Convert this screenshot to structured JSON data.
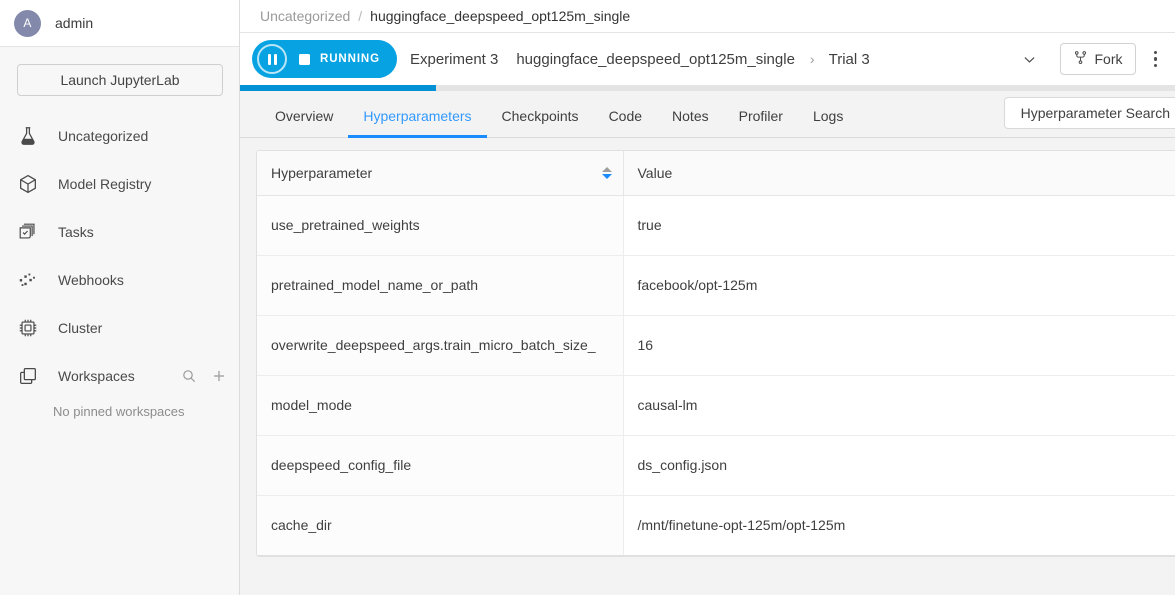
{
  "sidebar": {
    "user": {
      "initial": "A",
      "name": "admin"
    },
    "launch_button": "Launch JupyterLab",
    "items": [
      {
        "label": "Uncategorized",
        "icon": "flask-icon"
      },
      {
        "label": "Model Registry",
        "icon": "cube-icon"
      },
      {
        "label": "Tasks",
        "icon": "tasks-icon"
      },
      {
        "label": "Webhooks",
        "icon": "webhooks-icon"
      },
      {
        "label": "Cluster",
        "icon": "chip-icon"
      },
      {
        "label": "Workspaces",
        "icon": "workspaces-icon"
      }
    ],
    "workspaces_empty": "No pinned workspaces"
  },
  "breadcrumb": {
    "parent": "Uncategorized",
    "separator": "/",
    "current": "huggingface_deepspeed_opt125m_single"
  },
  "experiment_bar": {
    "status": "RUNNING",
    "experiment": "Experiment 3",
    "experiment_name": "huggingface_deepspeed_opt125m_single",
    "chevron": "›",
    "trial": "Trial 3",
    "fork_label": "Fork",
    "progress_percent": 21
  },
  "tabs": [
    {
      "label": "Overview",
      "active": false
    },
    {
      "label": "Hyperparameters",
      "active": true
    },
    {
      "label": "Checkpoints",
      "active": false
    },
    {
      "label": "Code",
      "active": false
    },
    {
      "label": "Notes",
      "active": false
    },
    {
      "label": "Profiler",
      "active": false
    },
    {
      "label": "Logs",
      "active": false
    }
  ],
  "hp_search_button": "Hyperparameter Search",
  "table": {
    "columns": [
      "Hyperparameter",
      "Value"
    ],
    "sort_column": "Hyperparameter",
    "sort_direction": "descending",
    "rows": [
      {
        "name": "use_pretrained_weights",
        "value": "true"
      },
      {
        "name": "pretrained_model_name_or_path",
        "value": "facebook/opt-125m"
      },
      {
        "name": "overwrite_deepspeed_args.train_micro_batch_size_",
        "value": "16"
      },
      {
        "name": "model_mode",
        "value": "causal-lm"
      },
      {
        "name": "deepspeed_config_file",
        "value": "ds_config.json"
      },
      {
        "name": "cache_dir",
        "value": "/mnt/finetune-opt-125m/opt-125m"
      }
    ]
  },
  "colors": {
    "accent_blue": "#0091d5",
    "status_blue": "#06a2e2",
    "tab_active": "#3399ff",
    "avatar": "#8289ab"
  }
}
